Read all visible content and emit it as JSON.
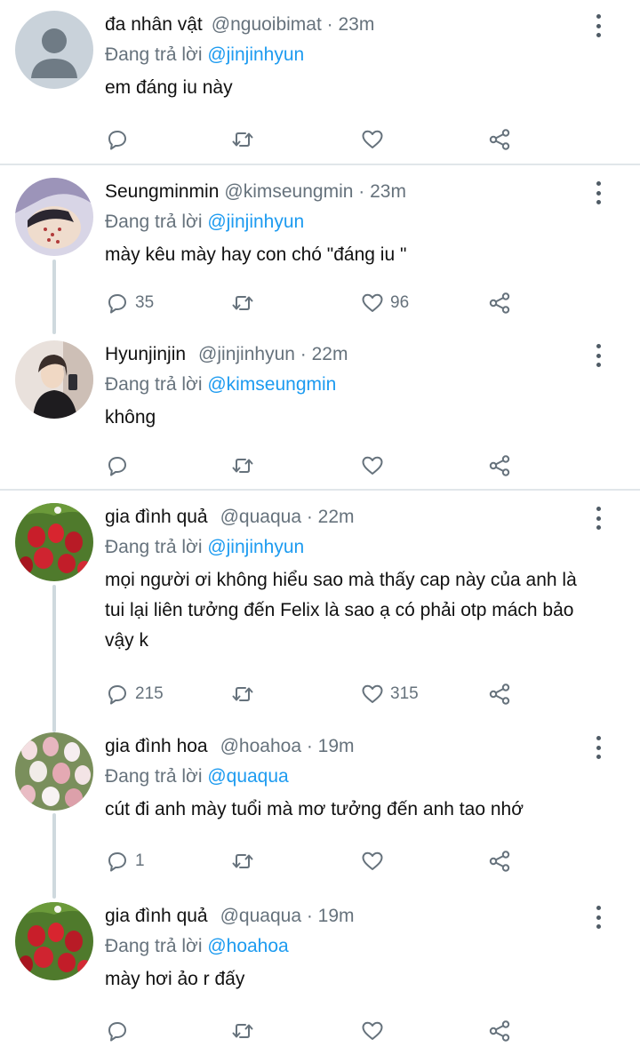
{
  "colors": {
    "accent": "#1d9bf0",
    "muted": "#66727c",
    "divider": "#e1e6ea",
    "thread_line": "#cfd9de"
  },
  "replying_prefix": "Đang trả lời",
  "tweets": [
    {
      "name": "đa nhân vật",
      "handle": "@nguoibimat",
      "time": "· 23m",
      "replying_to": "@jinjinhyun",
      "text": "em đáng iu này",
      "avatar": "default-avatar-icon",
      "reply_count": "",
      "like_count": ""
    },
    {
      "name": "Seungminmin",
      "handle": "@kimseungmin",
      "time": "· 23m",
      "replying_to": "@jinjinhyun",
      "text": "mày kêu mày hay con chó \"đáng iu \"",
      "avatar": "user-photo",
      "reply_count": "35",
      "like_count": "96"
    },
    {
      "name": "Hyunjinjin",
      "handle": "@jinjinhyun",
      "time": "· 22m",
      "replying_to": "@kimseungmin",
      "text": "không",
      "avatar": "user-photo",
      "reply_count": "",
      "like_count": ""
    },
    {
      "name": "gia đình quả",
      "handle": "@quaqua",
      "time": "· 22m",
      "replying_to": "@jinjinhyun",
      "text": "mọi người ơi không hiểu sao mà thấy cap này của anh là tui lại liên tưởng đến Felix là sao ạ có phải otp mách bảo vậy k",
      "avatar": "strawberry-photo",
      "reply_count": "215",
      "like_count": "315"
    },
    {
      "name": "gia đình hoa",
      "handle": "@hoahoa",
      "time": "· 19m",
      "replying_to": "@quaqua",
      "text": "cút đi anh mày tuổi mà mơ tưởng đến anh tao nhớ",
      "avatar": "flower-photo",
      "reply_count": "1",
      "like_count": ""
    },
    {
      "name": "gia đình quả",
      "handle": "@quaqua",
      "time": "· 19m",
      "replying_to": "@hoahoa",
      "text": "mày hơi ảo r đấy",
      "avatar": "strawberry-photo",
      "reply_count": "",
      "like_count": ""
    }
  ]
}
